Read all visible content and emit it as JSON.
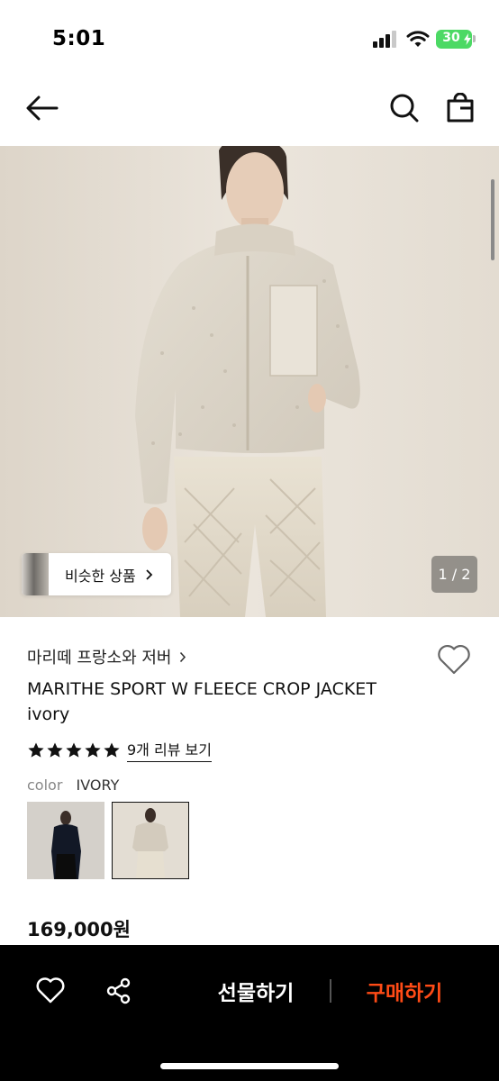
{
  "status_bar": {
    "time": "5:01",
    "battery": "30"
  },
  "header": {
    "back_icon": "arrow-left-icon",
    "search_icon": "search-icon",
    "cart_icon": "shopping-bag-icon"
  },
  "hero": {
    "similar_label": "비슷한 상품",
    "page_indicator": "1 / 2"
  },
  "product": {
    "brand": "마리떼 프랑소와 저버",
    "title": "MARITHE SPORT W FLEECE CROP JACKET ivory",
    "rating_stars": 5,
    "review_link": "9개 리뷰 보기",
    "color_label": "color",
    "color_value": "IVORY",
    "price": "169,000원"
  },
  "bottom_bar": {
    "gift_label": "선물하기",
    "buy_label": "구매하기",
    "buy_color": "#ff4b16"
  }
}
